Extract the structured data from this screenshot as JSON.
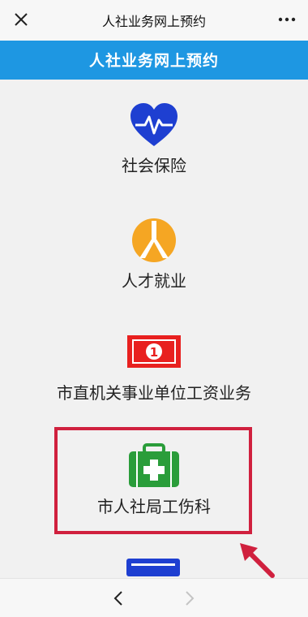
{
  "topbar": {
    "title": "人社业务网上预约"
  },
  "header": {
    "title": "人社业务网上预约"
  },
  "menu": [
    {
      "label": "社会保险",
      "icon": "heart-pulse-icon",
      "color": "#1e3fd1"
    },
    {
      "label": "人才就业",
      "icon": "person-circle-icon",
      "color": "#f5a623"
    },
    {
      "label": "市直机关事业单位工资业务",
      "icon": "banknote-icon",
      "color": "#e8201f"
    },
    {
      "label": "市人社局工伤科",
      "icon": "medical-kit-icon",
      "color": "#2a9d3a"
    }
  ],
  "highlight_color": "#d0203e",
  "nav": {
    "back": "back-icon",
    "forward": "forward-icon"
  }
}
